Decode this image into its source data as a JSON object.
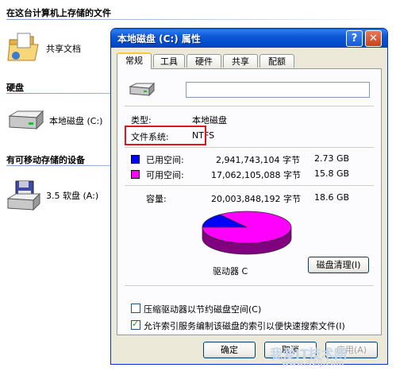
{
  "explorer": {
    "header": "在这台计算机上存储的文件",
    "shared_docs": "共享文档",
    "hdd_section": "硬盘",
    "local_disk": "本地磁盘 (C:)",
    "removable_section": "有可移动存储的设备",
    "floppy": "3.5 软盘 (A:)"
  },
  "dialog": {
    "title": "本地磁盘 (C:) 属性",
    "help_button": "?",
    "close_button": "✕",
    "tabs": [
      "常规",
      "工具",
      "硬件",
      "共享",
      "配额"
    ],
    "active_tab": "常规",
    "name_value": "",
    "type_label": "类型:",
    "type_value": "本地磁盘",
    "fs_label": "文件系统:",
    "fs_value": "NTFS",
    "used": {
      "label": "已用空间:",
      "bytes": "2,941,743,104 字节",
      "size": "2.73 GB",
      "color": "#0000ff"
    },
    "free": {
      "label": "可用空间:",
      "bytes": "17,062,105,088 字节",
      "size": "15.8 GB",
      "color": "#ff00ff"
    },
    "capacity": {
      "label": "容量:",
      "bytes": "20,003,848,192 字节",
      "size": "18.6 GB"
    },
    "used_fraction": 0.147,
    "drive_label": "驱动器 C",
    "cleanup_button": "磁盘清理(I)",
    "compress_checkbox": {
      "label": "压缩驱动器以节约磁盘空间(C)",
      "checked": false
    },
    "index_checkbox": {
      "label": "允许索引服务编制该磁盘的索引以便快速搜索文件(I)",
      "checked": true
    },
    "ok_button": "确定",
    "cancel_button": "取消",
    "apply_button": "应用(A)"
  },
  "watermark": {
    "main": "我爱IT技术网",
    "url": "www.52ij.com"
  }
}
